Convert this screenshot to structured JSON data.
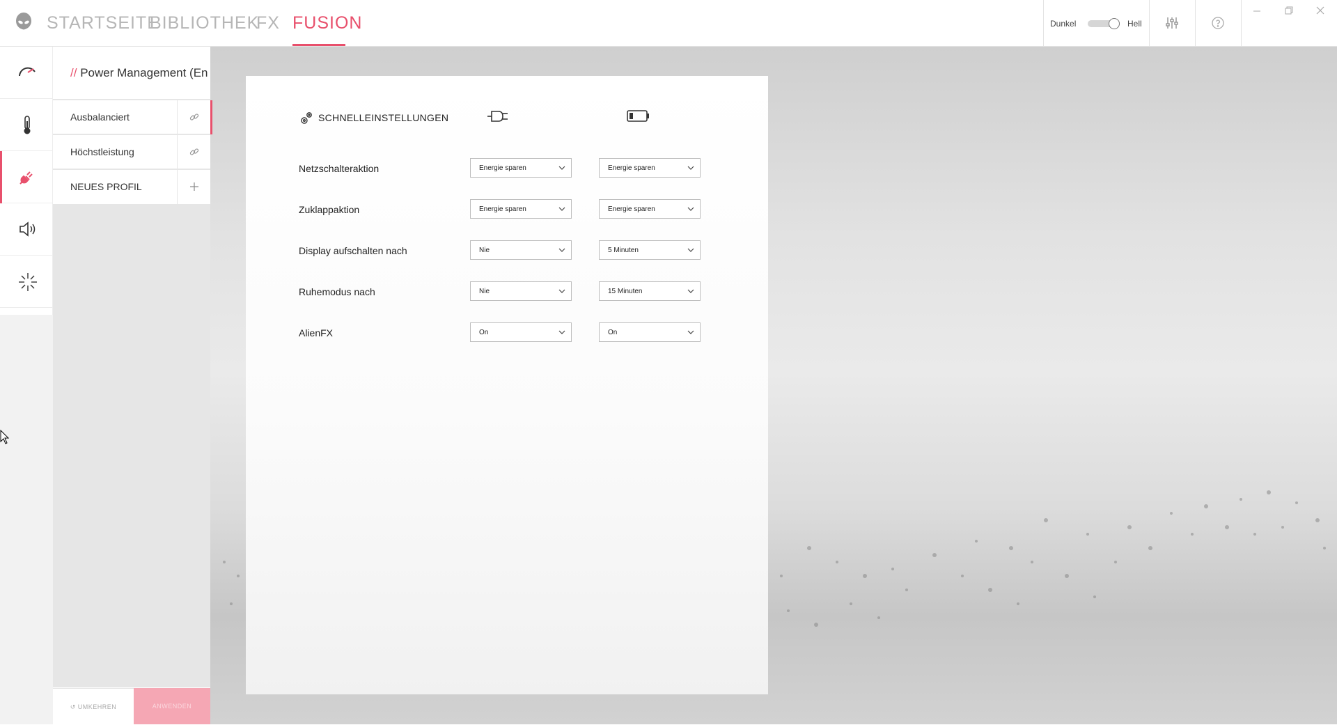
{
  "nav": {
    "tabs": [
      {
        "label": "STARTSEITE"
      },
      {
        "label": "BIBLIOTHEK"
      },
      {
        "label": "FX"
      },
      {
        "label": "FUSION",
        "active": true
      }
    ]
  },
  "header_right": {
    "theme_dark_label": "Dunkel",
    "theme_light_label": "Hell"
  },
  "rail": {
    "items": [
      {
        "icon": "gauge-icon"
      },
      {
        "icon": "thermometer-icon"
      },
      {
        "icon": "power-plug-icon",
        "active": true
      },
      {
        "icon": "speaker-icon"
      },
      {
        "icon": "light-burst-icon"
      }
    ]
  },
  "profiles": {
    "header": "Power Management (En",
    "header_prefix": "//",
    "items": [
      {
        "label": "Ausbalanciert",
        "action_icon": "link-icon"
      },
      {
        "label": "Höchstleistung",
        "action_icon": "link-icon"
      },
      {
        "label": "NEUES PROFIL",
        "action_icon": "plus-icon"
      }
    ],
    "revert_label": "↺ UMKEHREN",
    "apply_label": "ANWENDEN"
  },
  "quick_settings": {
    "title": "SCHNELLEINSTELLUNGEN",
    "column_icons": [
      "power-plug-icon",
      "battery-icon"
    ],
    "rows": [
      {
        "label": "Netzschalteraktion",
        "ac": "Energie sparen",
        "battery": "Energie sparen"
      },
      {
        "label": "Zuklappaktion",
        "ac": "Energie sparen",
        "battery": "Energie sparen"
      },
      {
        "label": "Display aufschalten nach",
        "ac": "Nie",
        "battery": "5 Minuten"
      },
      {
        "label": "Ruhemodus nach",
        "ac": "Nie",
        "battery": "15 Minuten"
      },
      {
        "label": "AlienFX",
        "ac": "On",
        "battery": "On"
      }
    ]
  },
  "colors": {
    "accent": "#e8506c",
    "apply_button": "#f5a7b4"
  }
}
